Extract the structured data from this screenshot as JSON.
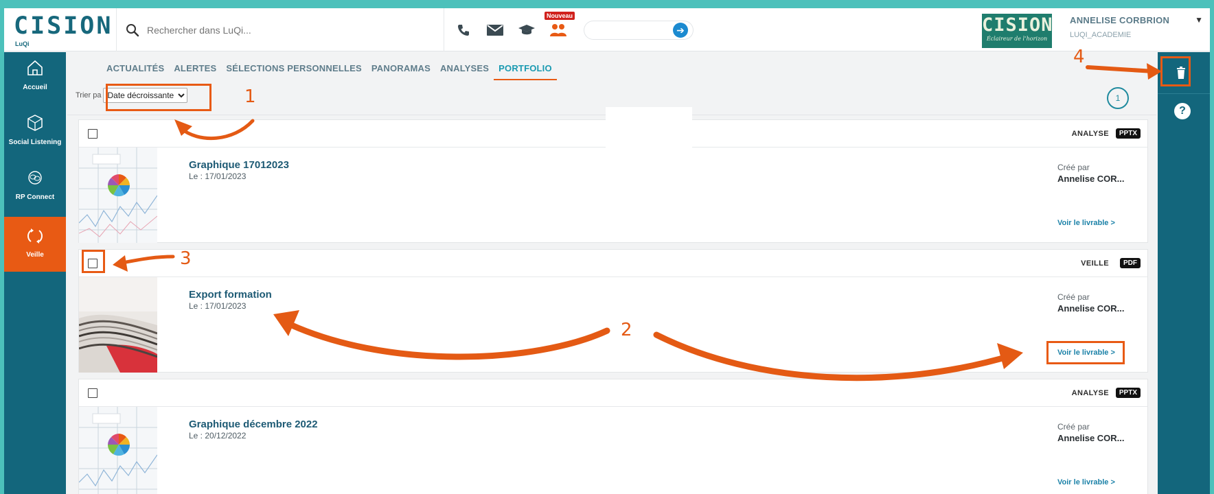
{
  "brand": {
    "wordmark": "CISION",
    "sub": "LuQi"
  },
  "search": {
    "placeholder": "Rechercher dans LuQi..."
  },
  "toolbar": {
    "icons": [
      "phone-icon",
      "mail-icon",
      "graduation-cap-icon",
      "people-icon"
    ],
    "new_badge": "Nouveau"
  },
  "partner_logo": {
    "wordmark": "CISION",
    "tagline": "Éclaireur de l’horizon"
  },
  "user": {
    "name": "ANNELISE CORBRION",
    "org": "LUQI_ACADEMIE",
    "caret": "▼"
  },
  "left_nav": {
    "items": [
      {
        "label": "Accueil",
        "icon": "home-icon"
      },
      {
        "label": "Social Listening",
        "icon": "cube-icon"
      },
      {
        "label": "RP Connect",
        "icon": "chat-icon"
      },
      {
        "label": "Veille",
        "icon": "loop-icon"
      }
    ],
    "active": "Veille"
  },
  "tabs": [
    "ACTUALITÉS",
    "ALERTES",
    "SÉLECTIONS PERSONNELLES",
    "PANORAMAS",
    "ANALYSES",
    "PORTFOLIO"
  ],
  "active_tab": "PORTFOLIO",
  "sort": {
    "label": "Trier pa",
    "selected": "Date décroissante"
  },
  "pagination": {
    "current": "1"
  },
  "cards": [
    {
      "type": "ANALYSE",
      "format": "PPTX",
      "title": "Graphique 17012023",
      "date": "Le : 17/01/2023",
      "created_by_label": "Créé par",
      "author": "Annelise COR...",
      "link": "Voir le livrable >"
    },
    {
      "type": "VEILLE",
      "format": "PDF",
      "title": "Export formation",
      "date": "Le : 17/01/2023",
      "created_by_label": "Créé par",
      "author": "Annelise COR...",
      "link": "Voir le livrable >"
    },
    {
      "type": "ANALYSE",
      "format": "PPTX",
      "title": "Graphique décembre 2022",
      "date": "Le : 20/12/2022",
      "created_by_label": "Créé par",
      "author": "Annelise COR...",
      "link": "Voir le livrable >"
    }
  ],
  "right_rail": {
    "help": "?",
    "icons": [
      "trash-icon",
      "help-icon"
    ]
  },
  "annotations": {
    "labels": [
      "1",
      "2",
      "3",
      "4"
    ],
    "color": "#e45a14"
  },
  "colors": {
    "teal_bg": "#4cc1bb",
    "nav": "#13667c",
    "accent": "#e85a14",
    "link": "#1c82a8"
  }
}
